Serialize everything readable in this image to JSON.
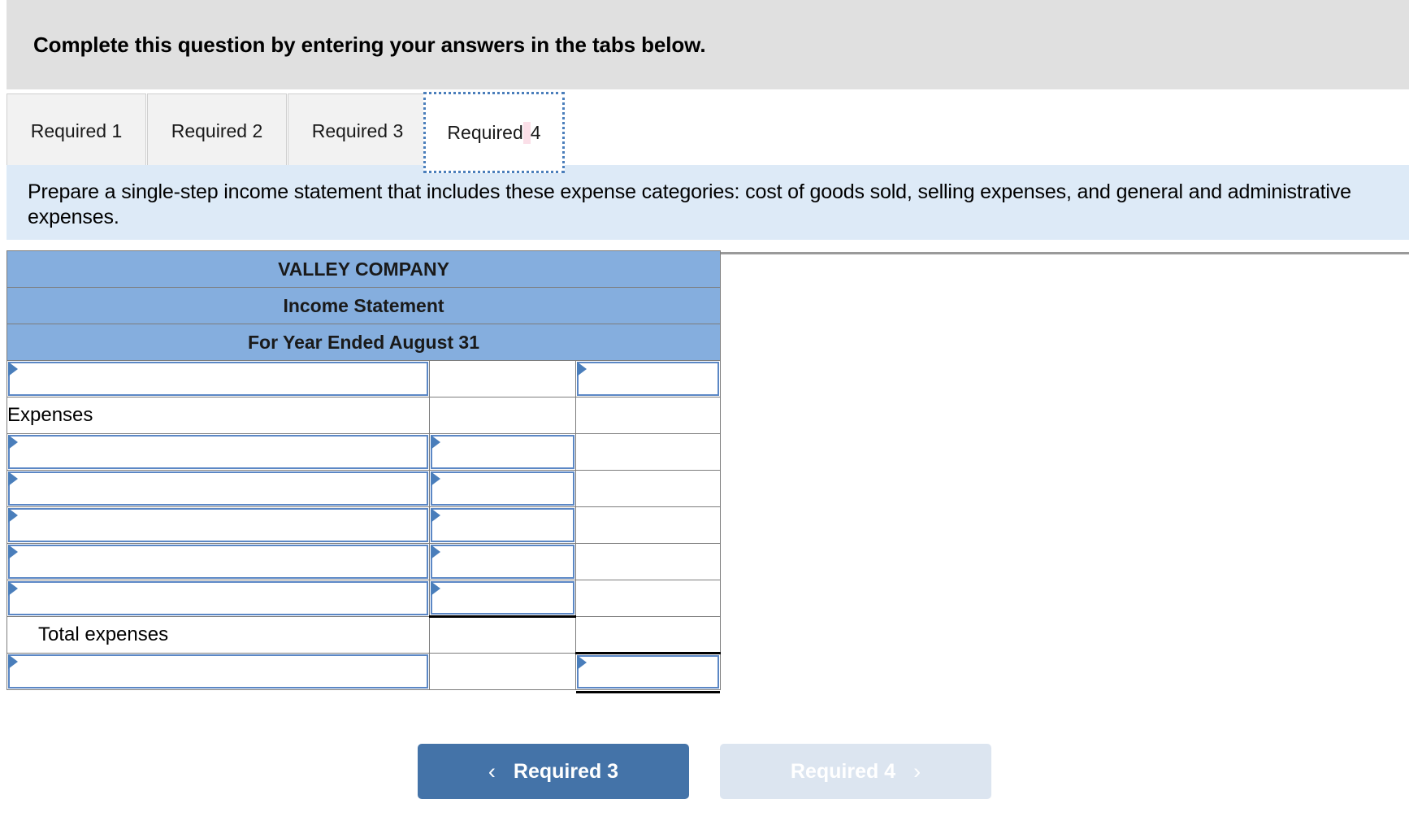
{
  "banner": {
    "text": "Complete this question by entering your answers in the tabs below."
  },
  "tabs": {
    "items": [
      {
        "label": "Required 1",
        "active": false
      },
      {
        "label": "Required 2",
        "active": false
      },
      {
        "label": "Required 3",
        "active": false
      },
      {
        "label": "Required 4",
        "active": true
      }
    ],
    "active_index": 3
  },
  "question": {
    "text": "Prepare a single-step income statement that includes these expense categories: cost of goods sold, selling expenses, and general and administrative expenses."
  },
  "statement": {
    "titles": [
      "VALLEY COMPANY",
      "Income Statement",
      "For Year Ended August 31"
    ],
    "rows": [
      {
        "label": "",
        "indent": false,
        "c1": "input",
        "c2": "blank",
        "c3": "input"
      },
      {
        "label": "Expenses",
        "indent": false,
        "c1": "label",
        "c2": "blank",
        "c3": "blank"
      },
      {
        "label": "",
        "indent": false,
        "c1": "input",
        "c2": "input",
        "c3": "blank"
      },
      {
        "label": "",
        "indent": false,
        "c1": "input",
        "c2": "input",
        "c3": "blank"
      },
      {
        "label": "",
        "indent": false,
        "c1": "input",
        "c2": "input",
        "c3": "blank"
      },
      {
        "label": "",
        "indent": false,
        "c1": "input",
        "c2": "input",
        "c3": "blank"
      },
      {
        "label": "",
        "indent": false,
        "c1": "input",
        "c2": "input-subtotal",
        "c3": "blank"
      },
      {
        "label": "Total expenses",
        "indent": true,
        "c1": "label",
        "c2": "blank",
        "c3": "blank"
      },
      {
        "label": "",
        "indent": false,
        "c1": "input",
        "c2": "blank",
        "c3": "input-total"
      }
    ]
  },
  "nav": {
    "prev": {
      "label": "Required 3",
      "chevron": "chevron-left",
      "glyph": "‹",
      "disabled": false
    },
    "next": {
      "label": "Required 4",
      "chevron": "chevron-right",
      "glyph": "›",
      "disabled": true
    }
  },
  "colors": {
    "banner_bg": "#e0e0e0",
    "question_bg": "#ddeaf7",
    "table_header_bg": "#85aede",
    "input_border": "#5b87c5",
    "primary_button": "#4473a8",
    "disabled_button": "#dce5f0",
    "focus_outline": "#4a7ebb",
    "caret_highlight": "#fbdfe8"
  }
}
